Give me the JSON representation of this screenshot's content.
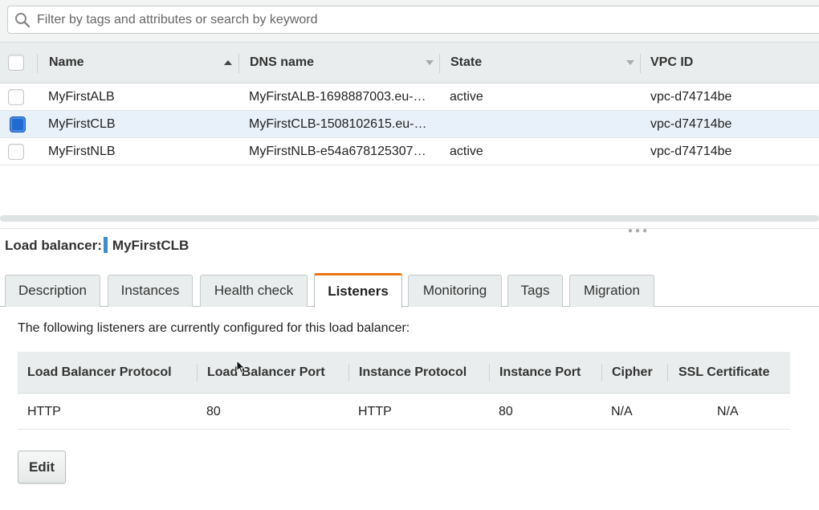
{
  "search": {
    "placeholder": "Filter by tags and attributes or search by keyword"
  },
  "load_balancers": {
    "columns": {
      "name": "Name",
      "dns": "DNS name",
      "state": "State",
      "vpc": "VPC ID"
    },
    "rows": [
      {
        "name": "MyFirstALB",
        "dns": "MyFirstALB-1698887003.eu-…",
        "state": "active",
        "vpc": "vpc-d74714be",
        "selected": false
      },
      {
        "name": "MyFirstCLB",
        "dns": "MyFirstCLB-1508102615.eu-…",
        "state": "",
        "vpc": "vpc-d74714be",
        "selected": true
      },
      {
        "name": "MyFirstNLB",
        "dns": "MyFirstNLB-e54a678125307…",
        "state": "active",
        "vpc": "vpc-d74714be",
        "selected": false
      }
    ]
  },
  "details": {
    "label_prefix": "Load balancer:",
    "label_name": "MyFirstCLB",
    "tabs": [
      "Description",
      "Instances",
      "Health check",
      "Listeners",
      "Monitoring",
      "Tags",
      "Migration"
    ],
    "active_tab": "Listeners",
    "intro": "The following listeners are currently configured for this load balancer:",
    "listeners": {
      "columns": [
        "Load Balancer Protocol",
        "Load Balancer Port",
        "Instance Protocol",
        "Instance Port",
        "Cipher",
        "SSL Certificate"
      ],
      "rows": [
        [
          "HTTP",
          "80",
          "HTTP",
          "80",
          "N/A",
          "N/A"
        ]
      ]
    },
    "edit_label": "Edit"
  },
  "colors": {
    "accent": "#ec7211",
    "selected_row": "#e8f0f9",
    "checkbox_checked": "#1f6bd1",
    "label_bar": "#3d8cd0"
  }
}
